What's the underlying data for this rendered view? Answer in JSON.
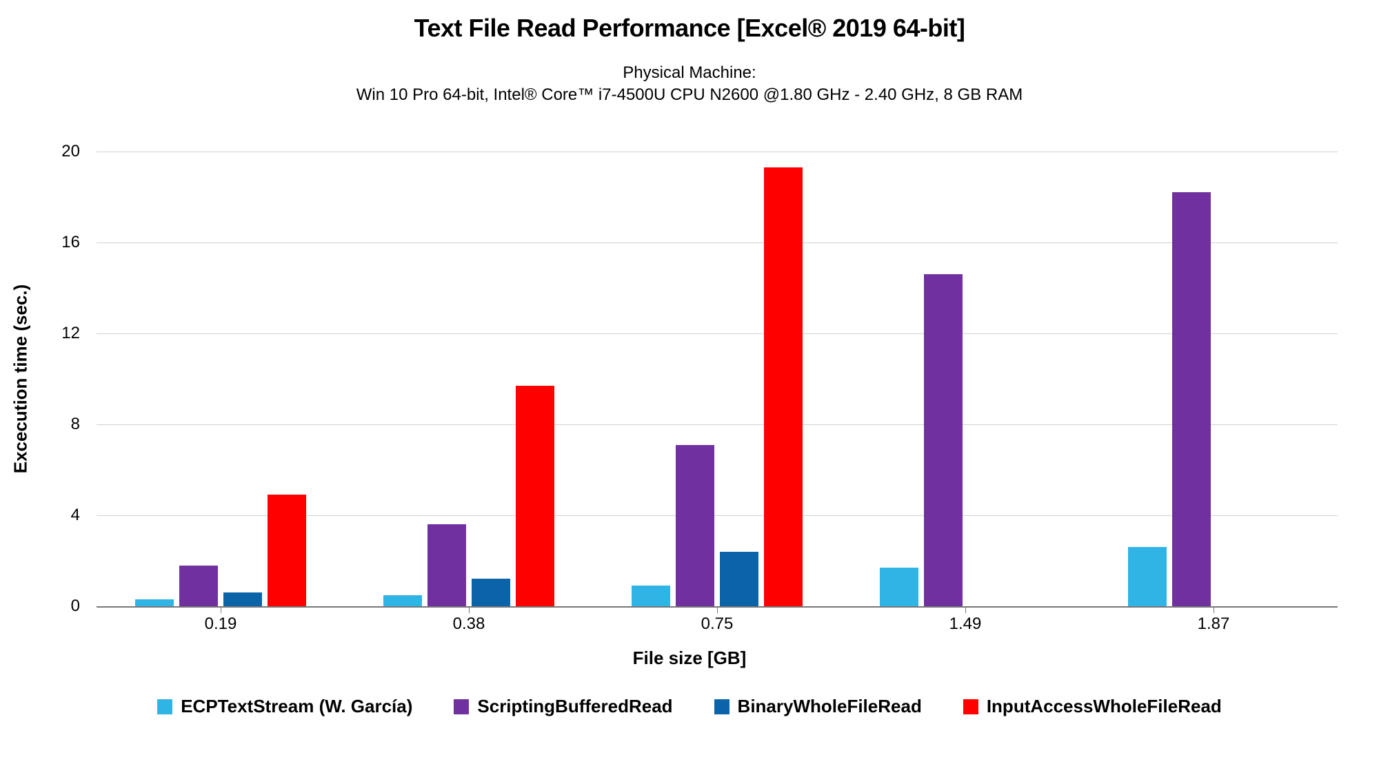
{
  "chart_data": {
    "type": "bar",
    "title": "Text File Read Performance [Excel® 2019 64-bit]",
    "subtitle_line1": "Physical Machine:",
    "subtitle_line2": "Win 10 Pro 64-bit, Intel® Core™ i7-4500U CPU N2600 @1.80 GHz - 2.40 GHz, 8 GB RAM",
    "xlabel": "File size [GB]",
    "ylabel": "Excecution time (sec.)",
    "ylim": [
      0,
      20
    ],
    "y_ticks": [
      0,
      4,
      8,
      12,
      16,
      20
    ],
    "categories": [
      "0.19",
      "0.38",
      "0.75",
      "1.49",
      "1.87"
    ],
    "series": [
      {
        "name": "ECPTextStream (W. García)",
        "color": "#30B4E5",
        "values": [
          0.3,
          0.5,
          0.9,
          1.7,
          2.6
        ]
      },
      {
        "name": "ScriptingBufferedRead",
        "color": "#7030A0",
        "values": [
          1.8,
          3.6,
          7.1,
          14.6,
          18.2
        ]
      },
      {
        "name": "BinaryWholeFileRead",
        "color": "#0C64A8",
        "values": [
          0.6,
          1.2,
          2.4,
          null,
          null
        ]
      },
      {
        "name": "InputAccessWholeFileRead",
        "color": "#FF0000",
        "values": [
          4.9,
          9.7,
          19.3,
          null,
          null
        ]
      }
    ]
  }
}
